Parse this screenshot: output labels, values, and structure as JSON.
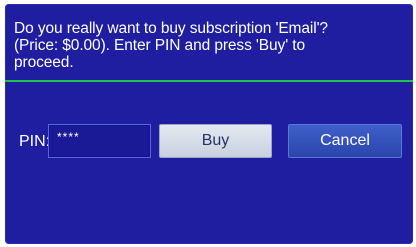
{
  "dialog": {
    "message_line1": "Do you really want to buy subscription 'Email'?",
    "message_line2": "(Price: $0.00). Enter PIN and press 'Buy' to",
    "message_line3": "proceed.",
    "pin_label": "PIN:",
    "pin_value": "****",
    "buy_label": "Buy",
    "cancel_label": "Cancel"
  },
  "colors": {
    "background": "#1f1ea0",
    "separator": "#22c24a",
    "buy_button": "#d6dce8",
    "cancel_button": "#3552bd",
    "text": "#ffffff"
  }
}
